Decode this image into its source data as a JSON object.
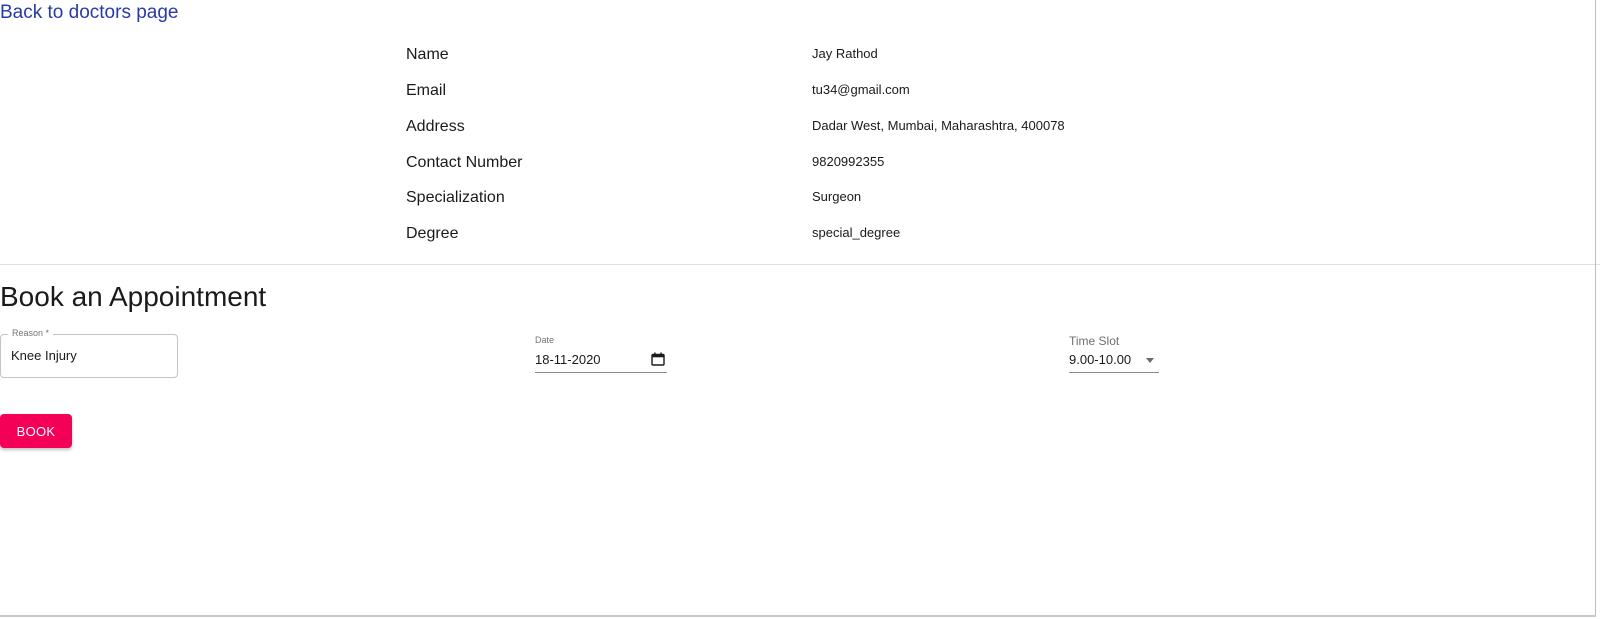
{
  "nav": {
    "back_link": "Back to doctors page"
  },
  "doctor": {
    "rows": [
      {
        "label": "Name",
        "value": "Jay Rathod"
      },
      {
        "label": "Email",
        "value": "tu34@gmail.com"
      },
      {
        "label": "Address",
        "value": "Dadar West, Mumbai, Maharashtra, 400078"
      },
      {
        "label": "Contact Number",
        "value": "9820992355"
      },
      {
        "label": "Specialization",
        "value": "Surgeon"
      },
      {
        "label": "Degree",
        "value": "special_degree"
      }
    ]
  },
  "appointment": {
    "title": "Book an Appointment",
    "reason": {
      "label": "Reason *",
      "value": "Knee Injury"
    },
    "date": {
      "label": "Date",
      "value": "18-11-2020"
    },
    "time_slot": {
      "label": "Time Slot",
      "value": "9.00-10.00"
    },
    "book_label": "BOOK"
  },
  "colors": {
    "link": "#283aa8",
    "accent": "#f50057"
  },
  "icons": {
    "date_picker": "calendar-icon",
    "time_slot_dropdown": "chevron-down-icon"
  }
}
